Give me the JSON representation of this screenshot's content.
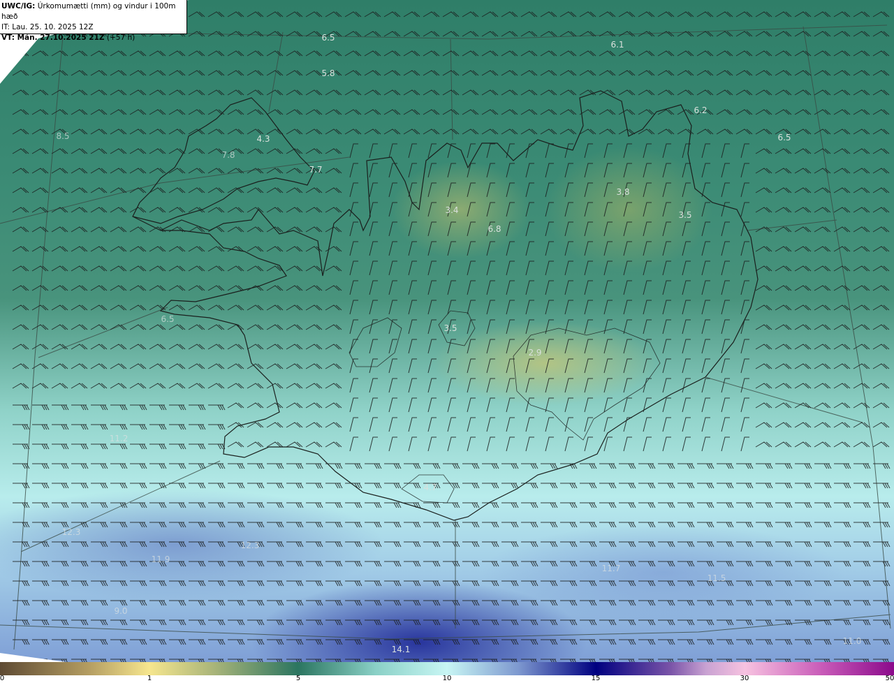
{
  "header": {
    "product": "UWC/IG:",
    "field": "Úrkomumætti (mm) og vindur i 100m hæð",
    "initial_time": "IT: Lau. 25. 10. 2025 12Z",
    "valid_time_label": "VT: Mán. 27.10.2025 21Z",
    "lead_time": "(+57 h)"
  },
  "map": {
    "value_labels": [
      "6.5",
      "6.1",
      "5.8",
      "6.2",
      "6.5",
      "8.5",
      "4.3",
      "7.8",
      "7.7",
      "3.4",
      "3.8",
      "3.5",
      "6.8",
      "3.5",
      "2.9",
      "6.5",
      "11.2",
      "4.7",
      "12.3",
      "12.3",
      "11.9",
      "11.7",
      "11.5",
      "9.0",
      "14.1",
      "11.0"
    ]
  },
  "colorbar": {
    "ticks": [
      "0",
      "1",
      "5",
      "10",
      "15",
      "30",
      "50"
    ],
    "colors": [
      "#5e4a33",
      "#f6e68e",
      "#2b7560",
      "#c8f6f4",
      "#000080",
      "#f7c2e0",
      "#8b0a8b"
    ]
  }
}
